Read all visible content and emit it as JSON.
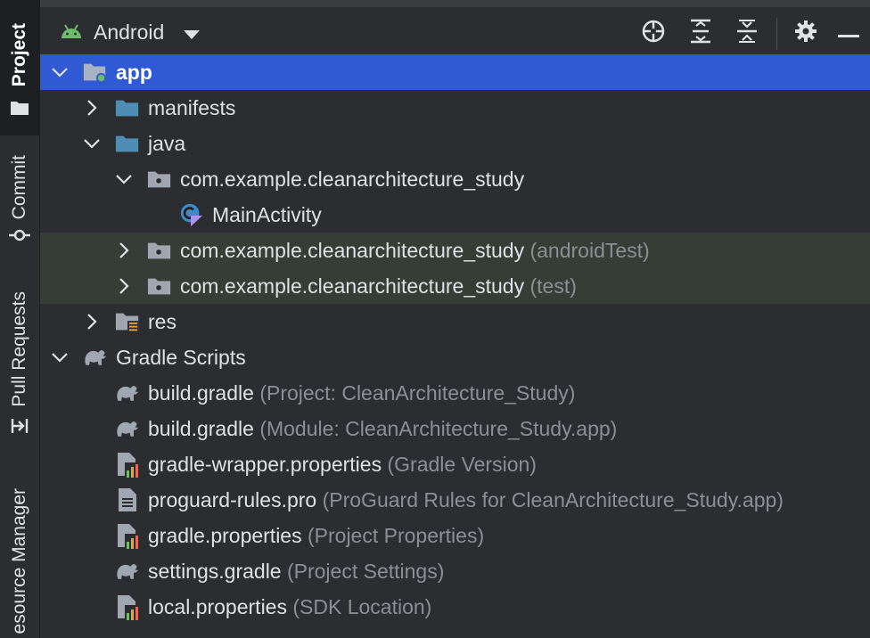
{
  "sidebar": {
    "tabs": [
      {
        "label": "Project",
        "icon": "folder-icon"
      },
      {
        "label": "Commit",
        "icon": "commit-icon"
      },
      {
        "label": "Pull Requests",
        "icon": "pull-request-icon"
      },
      {
        "label": "esource Manager",
        "icon": ""
      }
    ]
  },
  "toolbar": {
    "view_mode": "Android",
    "icons": [
      "locate-icon",
      "expand-all-icon",
      "collapse-all-icon",
      "settings-icon",
      "minimize-icon"
    ]
  },
  "colors": {
    "selection": "#2f5ad3",
    "background": "#2b2d30",
    "test_rows": "#353d36",
    "folder": "#4e8eb3",
    "android": "#6ebb6b",
    "hint": "#8c8f94",
    "local_properties": "#a6a432"
  },
  "tree": [
    {
      "label": "app",
      "hint": "",
      "icon": "module-folder-icon",
      "arrow": "down",
      "depth": 0
    },
    {
      "label": "manifests",
      "hint": "",
      "icon": "folder-icon",
      "arrow": "right",
      "depth": 1
    },
    {
      "label": "java",
      "hint": "",
      "icon": "folder-icon",
      "arrow": "down",
      "depth": 1
    },
    {
      "label": "com.example.cleanarchitecture_study",
      "hint": "",
      "icon": "package-icon",
      "arrow": "down",
      "depth": 2
    },
    {
      "label": "MainActivity",
      "hint": "",
      "icon": "kotlin-class-icon",
      "arrow": "",
      "depth": 3
    },
    {
      "label": "com.example.cleanarchitecture_study",
      "hint": "(androidTest)",
      "icon": "package-icon",
      "arrow": "right",
      "depth": 2
    },
    {
      "label": "com.example.cleanarchitecture_study",
      "hint": "(test)",
      "icon": "package-icon",
      "arrow": "right",
      "depth": 2
    },
    {
      "label": "res",
      "hint": "",
      "icon": "resources-folder-icon",
      "arrow": "right",
      "depth": 1
    },
    {
      "label": "Gradle Scripts",
      "hint": "",
      "icon": "gradle-elephant-icon",
      "arrow": "down",
      "depth": 0
    },
    {
      "label": "build.gradle",
      "hint": "(Project: CleanArchitecture_Study)",
      "icon": "gradle-elephant-icon",
      "arrow": "",
      "depth": 1
    },
    {
      "label": "build.gradle",
      "hint": "(Module: CleanArchitecture_Study.app)",
      "icon": "gradle-elephant-icon",
      "arrow": "",
      "depth": 1
    },
    {
      "label": "gradle-wrapper.properties",
      "hint": "(Gradle Version)",
      "icon": "properties-file-icon",
      "arrow": "",
      "depth": 1
    },
    {
      "label": "proguard-rules.pro",
      "hint": "(ProGuard Rules for CleanArchitecture_Study.app)",
      "icon": "text-file-icon",
      "arrow": "",
      "depth": 1
    },
    {
      "label": "gradle.properties",
      "hint": "(Project Properties)",
      "icon": "properties-file-icon",
      "arrow": "",
      "depth": 1
    },
    {
      "label": "settings.gradle",
      "hint": "(Project Settings)",
      "icon": "gradle-elephant-icon",
      "arrow": "",
      "depth": 1
    },
    {
      "label": "local.properties",
      "hint": "(SDK Location)",
      "icon": "properties-file-icon",
      "arrow": "",
      "depth": 1
    }
  ]
}
